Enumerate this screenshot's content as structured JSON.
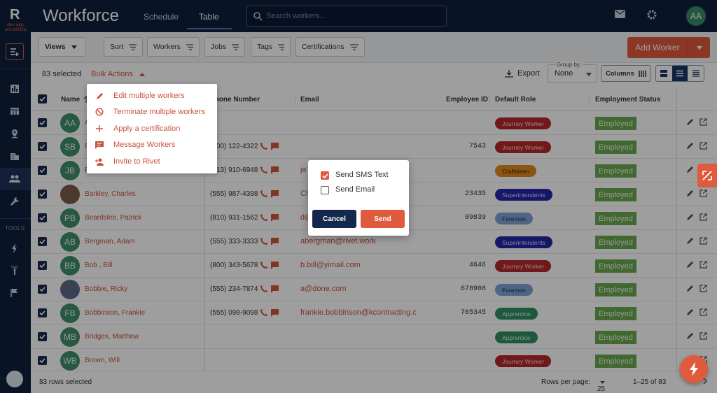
{
  "app": {
    "logo": "R",
    "env": "dev-app a01a91f2a",
    "title": "Workforce",
    "tabs": [
      {
        "label": "Schedule"
      },
      {
        "label": "Table"
      }
    ],
    "search_placeholder": "Search workers...",
    "user_initials": "AA"
  },
  "rail": {
    "tools_label": "TOOLS"
  },
  "toolbar": {
    "views": "Views",
    "filters": [
      "Sort",
      "Workers",
      "Jobs",
      "Tags",
      "Certifications"
    ],
    "add_worker": "Add Worker"
  },
  "subbar": {
    "selected": "83 selected",
    "bulk_actions": "Bulk Actions",
    "export": "Export",
    "group_by_label": "Group by:",
    "group_by_value": "None",
    "columns": "Columns"
  },
  "columns": {
    "name": "Name",
    "phone": "Phone Number",
    "email": "Email",
    "employee_id": "Employee ID",
    "default_role": "Default Role",
    "employment_status": "Employment Status"
  },
  "rows": [
    {
      "initials": "AA",
      "name": "A",
      "phone": "",
      "email": "",
      "eid": "",
      "role": "Journey Worker",
      "status": "Employed"
    },
    {
      "initials": "SB",
      "name": "B",
      "phone": "(800) 122-4322",
      "email": "",
      "eid": "7543",
      "role": "Journey Worker",
      "status": "Employed"
    },
    {
      "initials": "JB",
      "name": "B",
      "phone": "(313) 910-6948",
      "email": "je",
      "eid": "",
      "role": "Craftsmen",
      "status": "Employed"
    },
    {
      "initials": "",
      "name": "Barkley, Charles",
      "phone": "(555) 987-4398",
      "email": "Ch",
      "eid": "23435",
      "role": "Superintendents",
      "status": "Employed"
    },
    {
      "initials": "PB",
      "name": "Beardslee, Patrick",
      "phone": "(810) 931-1562",
      "email": "d@",
      "eid": "09839",
      "role": "Foreman",
      "status": "Employed"
    },
    {
      "initials": "AB",
      "name": "Bergman, Adam",
      "phone": "(555) 333-3333",
      "email": "abergman@rivet.work",
      "eid": "",
      "role": "Superintendents",
      "status": "Employed"
    },
    {
      "initials": "BB",
      "name": "Bob , Bill",
      "phone": "(800) 343-5678",
      "email": "b.bill@yimail.com",
      "eid": "4646",
      "role": "Journey Worker",
      "status": "Employed"
    },
    {
      "initials": "",
      "name": "Bobbie, Ricky",
      "phone": "(555) 234-7874",
      "email": "a@done.com",
      "eid": "678908",
      "role": "Foreman",
      "status": "Employed"
    },
    {
      "initials": "FB",
      "name": "Bobbinson, Frankie",
      "phone": "(555) 098-9098",
      "email": "frankie.bobbinson@kcontracting.c",
      "eid": "765345",
      "role": "Apprentice",
      "status": "Employed"
    },
    {
      "initials": "MB",
      "name": "Bridges, Matthew",
      "phone": "",
      "email": "",
      "eid": "",
      "role": "Apprentice",
      "status": "Employed"
    },
    {
      "initials": "WB",
      "name": "Brown, Will",
      "phone": "",
      "email": "",
      "eid": "",
      "role": "Journey Worker",
      "status": "Employed"
    }
  ],
  "role_colors": {
    "Journey Worker": {
      "bg": "#b5282a",
      "fg": "#f4d6d6"
    },
    "Craftsmen": {
      "bg": "#e08a1e",
      "fg": "#3a2405"
    },
    "Superintendents": {
      "bg": "#2426a8",
      "fg": "#dadcf8"
    },
    "Foreman": {
      "bg": "#7ea3d9",
      "fg": "#1f3356"
    },
    "Apprentice": {
      "bg": "#2f8f63",
      "fg": "#d8f0e4"
    }
  },
  "footer": {
    "rows_selected": "83 rows selected",
    "rows_per_page_label": "Rows per page:",
    "rows_per_page": "25",
    "range": "1–25 of 83"
  },
  "bulk_menu": [
    {
      "label": "Edit multiple workers",
      "icon": "pencil-icon"
    },
    {
      "label": "Terminate multiple workers",
      "icon": "block-icon"
    },
    {
      "label": "Apply a certification",
      "icon": "plus-icon"
    },
    {
      "label": "Message Workers",
      "icon": "message-icon"
    },
    {
      "label": "Invite to Rivet",
      "icon": "person-add-icon"
    }
  ],
  "dialog": {
    "sms_label": "Send SMS Text",
    "sms_checked": true,
    "email_label": "Send Email",
    "email_checked": false,
    "cancel": "Cancel",
    "send": "Send"
  }
}
